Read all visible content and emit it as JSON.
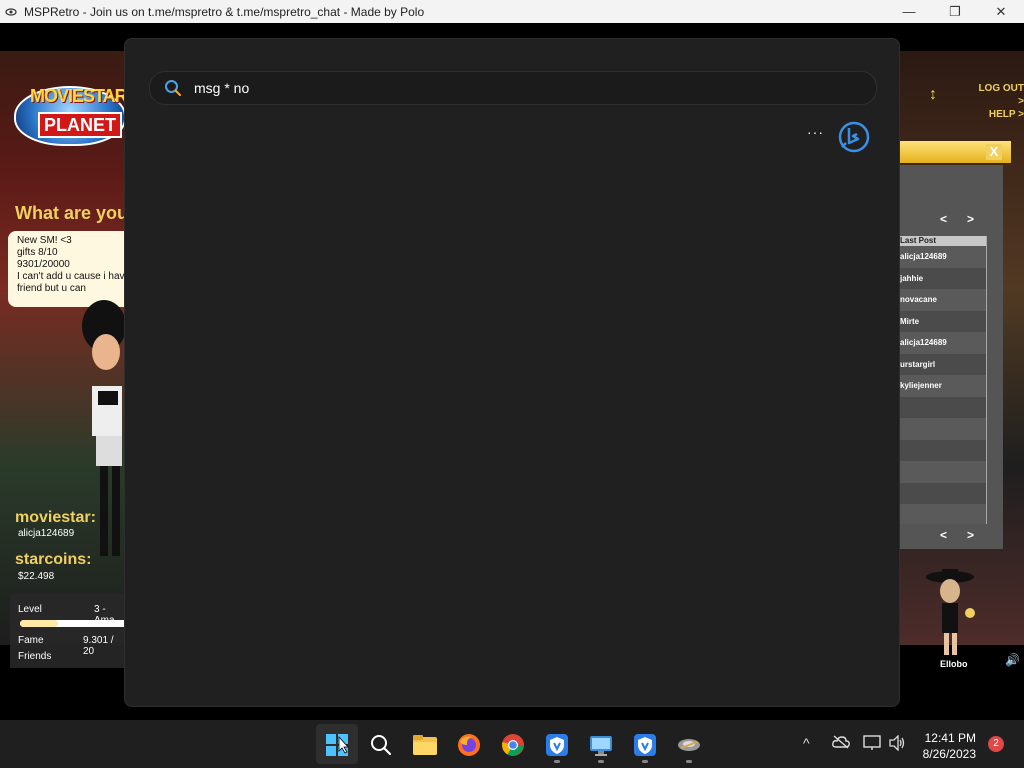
{
  "window": {
    "title": "MSPRetro - Join us on t.me/mspretro & t.me/mspretro_chat - Made by Polo",
    "minimize": "—",
    "maximize": "❐",
    "close": "✕"
  },
  "game": {
    "logo_top": "MOVIESTAR",
    "logo_bottom": "PLANET",
    "what_are_you_doing": "What are you doin",
    "status_lines": [
      "New SM! <3",
      "gifts 8/10",
      "9301/20000",
      "I can't add u cause i have",
      "friend but u can"
    ],
    "moviestar_label": "moviestar:",
    "moviestar_name": "alicja124689",
    "starcoins_label": "starcoins:",
    "starcoins_value": "$22.498",
    "level_label": "Level",
    "level_value": "3 - Ama",
    "level_progress": 0.35,
    "fame_label": "Fame",
    "fame_value": "9.301 / 20",
    "friends_label": "Friends",
    "log_out": "LOG OUT >",
    "help": "HELP >",
    "close_x": "X",
    "nav_prev": "<",
    "nav_next": ">",
    "table_header": "Last Post",
    "table_rows": [
      "alicja124689",
      "jahhie",
      "novacane",
      "Mirte",
      "alicja124689",
      "urstargirl",
      "kyliejenner",
      "",
      "",
      "",
      "",
      "",
      ""
    ],
    "friend_name": "Ellobo"
  },
  "search": {
    "query": "msg * no",
    "more_label": "···"
  },
  "taskbar": {
    "time": "12:41 PM",
    "date": "8/26/2023",
    "notification_count": "2",
    "tray_up": "^"
  }
}
